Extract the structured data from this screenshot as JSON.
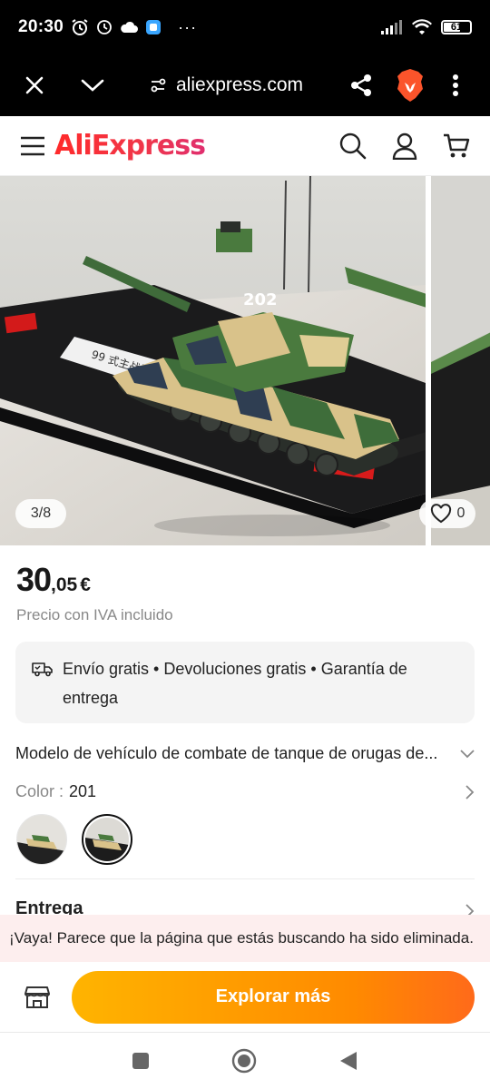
{
  "status_bar": {
    "time": "20:30",
    "more": "···",
    "battery": "61"
  },
  "browser": {
    "url": "aliexpress.com"
  },
  "header": {
    "logo": "AliExpress",
    "brand_color": "#ff2a2a"
  },
  "gallery": {
    "counter": "3/8",
    "wishlist_count": "0"
  },
  "product": {
    "price_int": "30",
    "price_dec": ",05",
    "currency": "€",
    "tax_note": "Precio con IVA incluido",
    "shipping": "Envío gratis • Devoluciones gratis • Garantía de entrega",
    "title": "Modelo de vehículo de combate de tanque de orugas de...",
    "color_label": "Color :",
    "color_value": "201",
    "delivery_label": "Entrega"
  },
  "alert": {
    "text": "¡Vaya! Parece que la página que estás buscando ha sido eliminada."
  },
  "actions": {
    "explore": "Explorar más",
    "explore_color": "#ff8a00"
  }
}
